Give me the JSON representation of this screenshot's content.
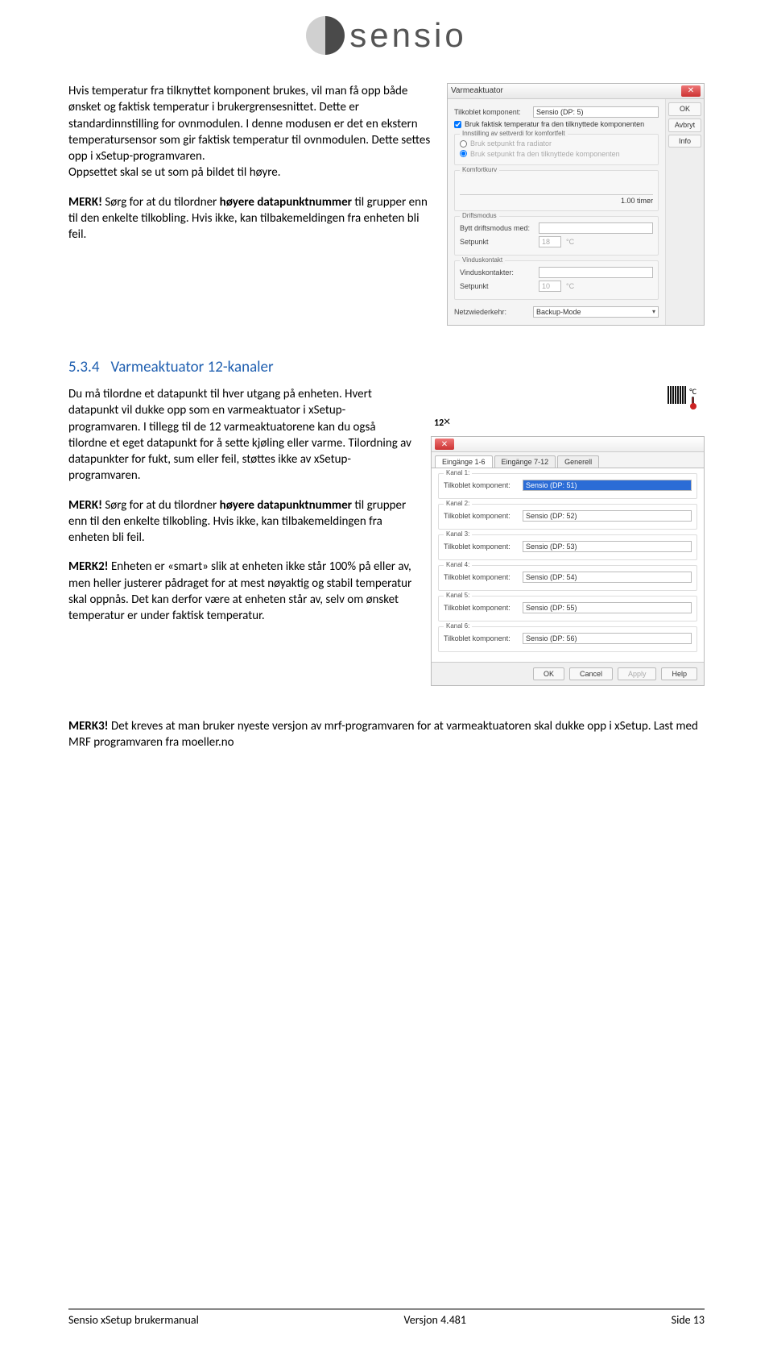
{
  "logo_text": "sensio",
  "body": {
    "p1": "Hvis temperatur fra tilknyttet komponent brukes, vil man få opp både ønsket og faktisk temperatur i brukergrensesnittet. Dette er standardinnstilling for ovnmodulen. I denne modusen er det en ekstern temperatursensor som gir faktisk temperatur til ovnmodulen. Dette settes opp i xSetup-programvaren.",
    "p1b": "Oppsettet skal se ut som på bildet til høyre.",
    "merk_label": "MERK!",
    "merk_text": " Sørg for at du tilordner ",
    "merk_bold": "høyere datapunktnummer",
    "merk_tail": " til grupper enn til den enkelte tilkobling. Hvis ikke, kan tilbakemeldingen fra enheten bli feil.",
    "heading_num": "5.3.4",
    "heading_txt": "Varmeaktuator 12-kanaler",
    "p2": "Du må tilordne et datapunkt til hver utgang på enheten. Hvert datapunkt vil dukke opp som en varmeaktuator i xSetup-programvaren. I tillegg til de 12 varmeaktuatorene kan du også tilordne et eget datapunkt for å sette kjøling eller varme. Tilordning av datapunkter for fukt, sum eller feil, støttes ikke av xSetup-programvaren.",
    "merk2_label": "MERK2!",
    "merk2_text": " Enheten er «smart» slik at enheten ikke står 100% på eller av, men heller justerer pådraget for at mest nøyaktig og stabil temperatur skal oppnås. Det kan derfor være at enheten står av, selv om ønsket temperatur er under faktisk temperatur.",
    "merk3_label": "MERK3!",
    "merk3_text": " Det kreves at man bruker nyeste versjon av mrf-programvaren for at varmeaktuatoren skal dukke opp i xSetup. Last med MRF programvaren fra moeller.no"
  },
  "dialog1": {
    "title": "Varmeaktuator",
    "side": {
      "ok": "OK",
      "avbryt": "Avbryt",
      "info": "Info"
    },
    "tilkoblet_lbl": "Tilkoblet komponent:",
    "tilkoblet_val": "Sensio (DP: 5)",
    "chk1": "Bruk faktisk temperatur fra den tilknyttede komponenten",
    "grp_innstilling": "Innstilling av settverdi for komfortfelt",
    "radio1": "Bruk setpunkt fra radiator",
    "radio2": "Bruk setpunkt fra den tilknyttede komponenten",
    "grp_komfort": "Komfortkurv",
    "komfort_val": "1.00 timer",
    "grp_drift": "Driftsmodus",
    "drift_lbl": "Bytt driftsmodus med:",
    "setpunkt_lbl": "Setpunkt",
    "setpunkt_val": "18",
    "c": "°C",
    "grp_vindus": "Vinduskontakt",
    "vindus_lbl": "Vinduskontakter:",
    "setpunkt2_val": "10",
    "netz_lbl": "Netzwiederkehr:",
    "netz_val": "Backup-Mode"
  },
  "channel_icon": {
    "count": "12",
    "x": "×",
    "deg": "°C"
  },
  "dialog2": {
    "tabs": [
      "Eingänge 1-6",
      "Eingänge 7-12",
      "Generell"
    ],
    "tilkoblet_lbl": "Tilkoblet komponent:",
    "kanals": [
      {
        "title": "Kanal 1:",
        "value": "Sensio (DP: 51)",
        "sel": true
      },
      {
        "title": "Kanal 2:",
        "value": "Sensio (DP: 52)",
        "sel": false
      },
      {
        "title": "Kanal 3:",
        "value": "Sensio (DP: 53)",
        "sel": false
      },
      {
        "title": "Kanal 4:",
        "value": "Sensio (DP: 54)",
        "sel": false
      },
      {
        "title": "Kanal 5:",
        "value": "Sensio (DP: 55)",
        "sel": false
      },
      {
        "title": "Kanal 6:",
        "value": "Sensio (DP: 56)",
        "sel": false
      }
    ],
    "buttons": {
      "ok": "OK",
      "cancel": "Cancel",
      "apply": "Apply",
      "help": "Help"
    }
  },
  "footer": {
    "left": "Sensio xSetup brukermanual",
    "center": "Versjon 4.481",
    "right": "Side 13"
  }
}
